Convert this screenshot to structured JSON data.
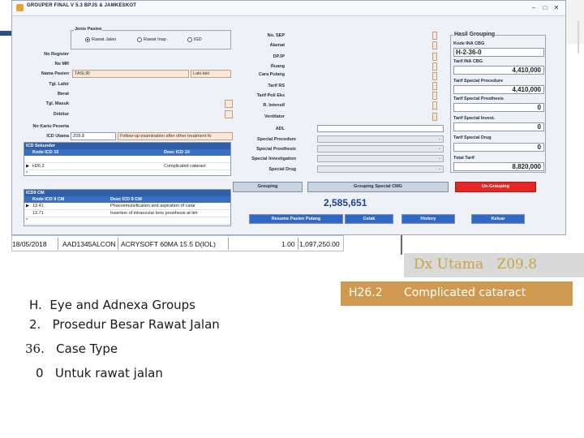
{
  "window": {
    "title": "GROUPER FINAL V 5.3  BPJS & JAMKESKOT",
    "buttons": [
      "–",
      "□",
      "✕"
    ]
  },
  "left_form": {
    "jenis_pasien": {
      "title": "Jenis Pasien",
      "options": [
        "Rawat Jalan",
        "Rawat Inap",
        "IGD"
      ],
      "selected": "Rawat Jalan"
    },
    "labels": {
      "no_register": "No Register",
      "no_mr": "No MR",
      "nama_pasien": "Nama Pasien",
      "tgl_lahir": "Tgl. Lahir",
      "berat": "Berat",
      "tgl_masuk": "Tgl. Masuk",
      "debitur": "Debitur",
      "no_kartu": "No Kartu Peserta",
      "icd_utama": "ICD Utama"
    },
    "nama_value": "TASLIR",
    "gender_value": "Laki-laki",
    "icd_utama_code": "Z09.8",
    "icd_utama_desc": "Follow-up examination after other treatment fo"
  },
  "icd10_grid": {
    "caption": "ICD Sekunder",
    "headers": [
      "Kode ICD 10",
      "Desc ICD 10"
    ],
    "rows": [
      {
        "marker": "",
        "code": "",
        "desc": ""
      },
      {
        "marker": "▶",
        "code": "H26.2",
        "desc": "Complicated cataract"
      },
      {
        "marker": "*",
        "code": "",
        "desc": ""
      }
    ]
  },
  "icd9_grid": {
    "caption": "ICD9 CM",
    "headers": [
      "Kode ICD 9 CM",
      "Desc ICD 9 CM"
    ],
    "rows": [
      {
        "marker": "▶",
        "code": "13.41",
        "desc": "Phacoemulsification and aspiration of catar"
      },
      {
        "marker": "",
        "code": "13.71",
        "desc": "Insertion of intraocular lens prosthesis at tim"
      },
      {
        "marker": "*",
        "code": "",
        "desc": ""
      }
    ]
  },
  "middle_form": {
    "labels": {
      "no_sep": "No. SEP",
      "alamat": "Alamat",
      "dpjp": "DPJP",
      "ruang": "Ruang",
      "cara_pulang": "Cara Pulang",
      "tarif_rs": "Tarif RS",
      "tarif_poli": "Tarif Poli Eks",
      "r_intensif": "R. Intensif",
      "ventilator": "Ventilator",
      "adl": "ADL",
      "special_procedure": "Special Procedure",
      "special_prosthesis": "Special Prosthesis",
      "special_investigation": "Special Investigation",
      "special_drug": "Special Drug"
    }
  },
  "hasil_grouping": {
    "title": "Hasil Grouping",
    "kode_label": "Kode INA CBG",
    "kode_value": "H-2-36-0",
    "tarif_ina_label": "Tarif INA CBG",
    "tarif_ina_value": "4,410,000",
    "tarif_sp_proc_label": "Tarif Special Procedure",
    "tarif_sp_proc_value": "4,410,000",
    "tarif_sp_pros_label": "Tarif Special Prosthesis",
    "tarif_sp_pros_value": "0",
    "tarif_sp_inv_label": "Tarif Special Invest.",
    "tarif_sp_inv_value": "0",
    "tarif_sp_drug_label": "Tarif Special Drug",
    "tarif_sp_drug_value": "0",
    "total_label": "Total Tarif",
    "total_value": "8,820,000"
  },
  "buttons": {
    "grouping": "Grouping",
    "grouping_special": "Grouping Special CMG",
    "ungrouping": "Un-Grouping",
    "resume": "Resume Pasien Pulang",
    "cetak": "Cetak",
    "history": "History",
    "keluar": "Keluar"
  },
  "big_value": "2,585,651",
  "bottom_strip": {
    "date": "18/05/2018",
    "code": "AAD1345ALCON",
    "item": "ACRYSOFT 60MA 15.5 D(IOL)",
    "qty": "1.00",
    "price": "1,097,250.00"
  },
  "slide": {
    "dx_label": "Dx Utama",
    "dx_code": "Z09.8",
    "icd_code": "H26.2",
    "icd_desc": "Complicated cataract",
    "lines": [
      {
        "num": "H.",
        "text": "Eye and Adnexa Groups"
      },
      {
        "num": "2.",
        "text": "Prosedur Besar Rawat Jalan"
      },
      {
        "num": "36.",
        "text": "Case Type"
      },
      {
        "num": "0",
        "text": "Untuk rawat jalan"
      }
    ]
  }
}
